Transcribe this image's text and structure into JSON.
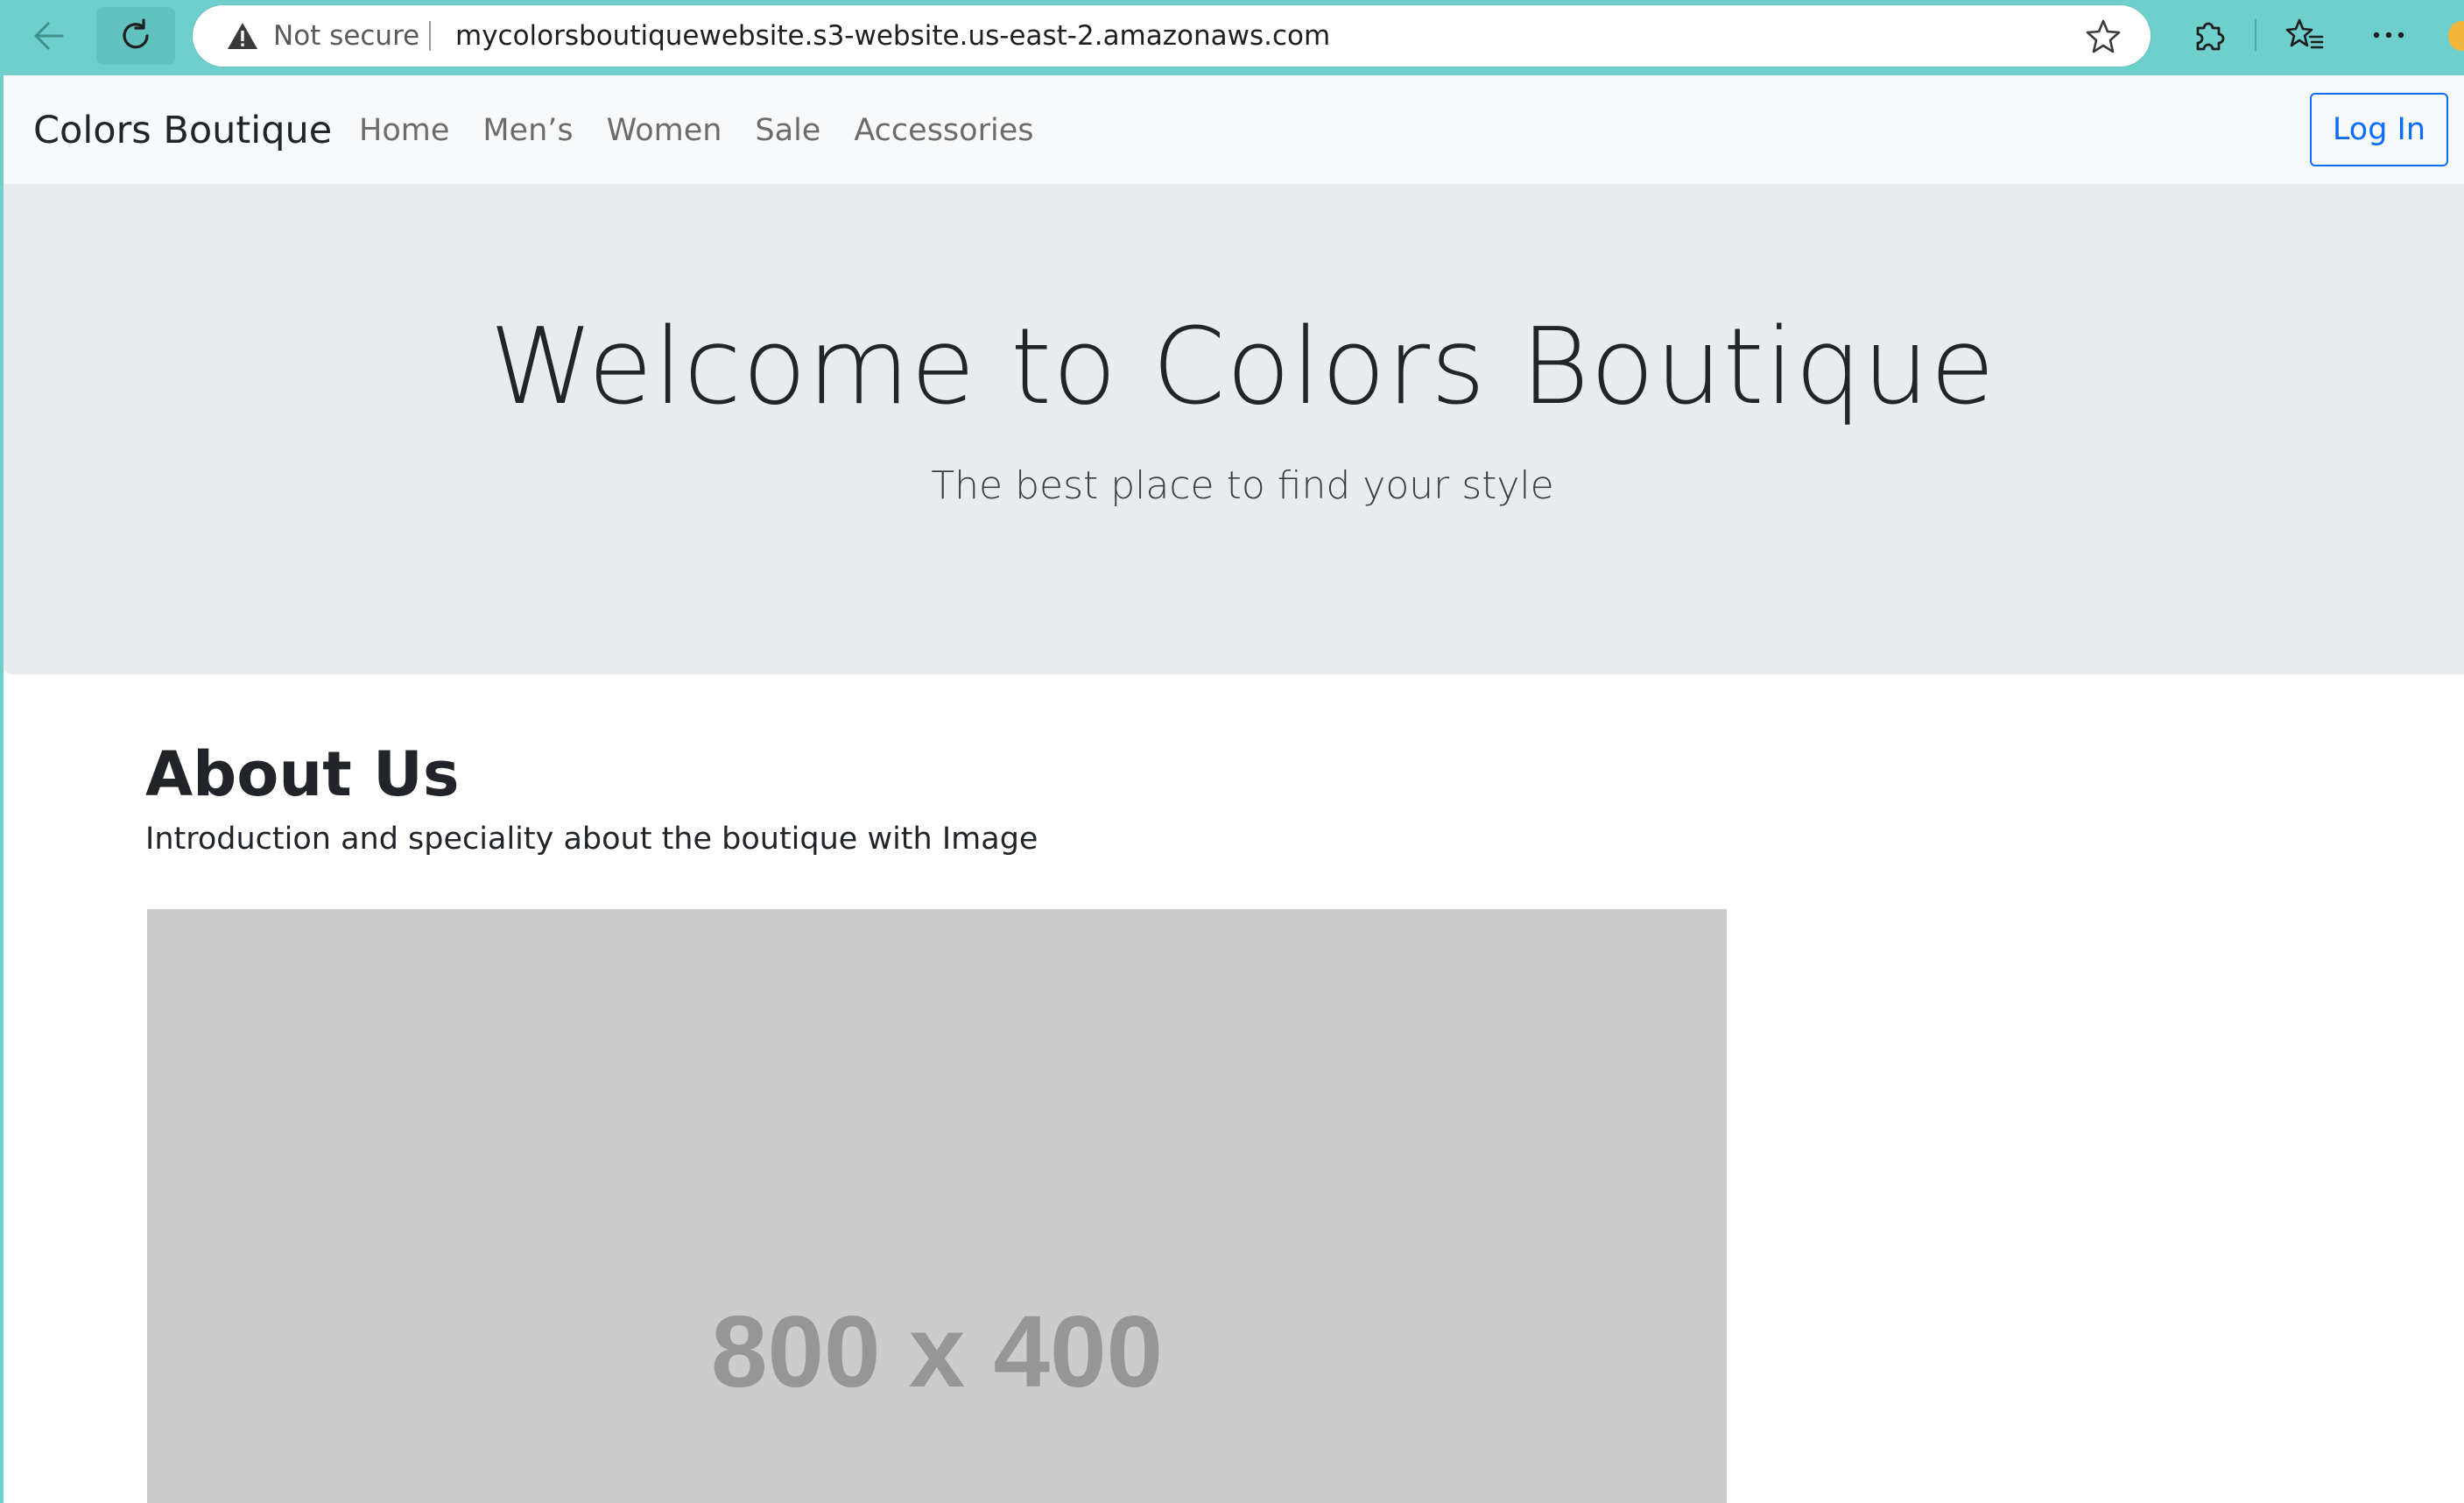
{
  "browser": {
    "security_label": "Not secure",
    "url": "mycolorsboutiquewebsite.s3-website.us-east-2.amazonaws.com",
    "icons": [
      "back-arrow-icon",
      "reload-icon",
      "warning-icon",
      "star-icon",
      "extensions-icon",
      "favorites-icon",
      "more-icon"
    ],
    "accent_color": "#6fcfcd"
  },
  "navbar": {
    "brand": "Colors Boutique",
    "links": [
      "Home",
      "Men’s",
      "Women",
      "Sale",
      "Accessories"
    ],
    "login_label": "Log In",
    "login_color": "#0d6efd"
  },
  "hero": {
    "title": "Welcome to Colors Boutique",
    "subtitle": "The best place to find your style"
  },
  "about": {
    "title": "About Us",
    "text": "Introduction and speciality about the boutique with Image",
    "image_label": "800 x 400"
  }
}
